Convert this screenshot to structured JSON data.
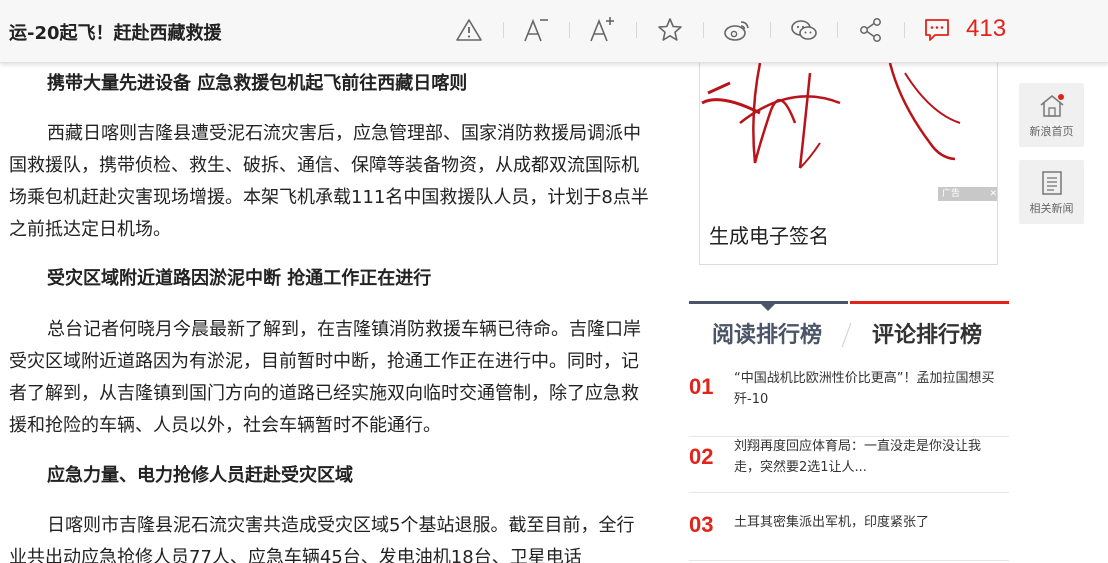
{
  "header": {
    "title": "运-20起飞！赶赴西藏救援",
    "comment_count": "413",
    "accent_color": "#e2231a",
    "icons": [
      "report-icon",
      "font-decrease-icon",
      "font-increase-icon",
      "star-icon",
      "weibo-icon",
      "wechat-icon",
      "share-icon",
      "comment-icon"
    ]
  },
  "article": {
    "paragraphs": [
      {
        "type": "subheading",
        "text": "携带大量先进设备 应急救援包机起飞前往西藏日喀则"
      },
      {
        "type": "body",
        "text": "西藏日喀则吉隆县遭受泥石流灾害后，应急管理部、国家消防救援局调派中国救援队，携带侦检、救生、破拆、通信、保障等装备物资，从成都双流国际机场乘包机赶赴灾害现场增援。本架飞机承载111名中国救援队人员，计划于8点半之前抵达定日机场。"
      },
      {
        "type": "subheading",
        "text": "受灾区域附近道路因淤泥中断 抢通工作正在进行"
      },
      {
        "type": "body",
        "text": "总台记者何晓月今晨最新了解到，在吉隆镇消防救援车辆已待命。吉隆口岸受灾区域附近道路因为有淤泥，目前暂时中断，抢通工作正在进行中。同时，记者了解到，从吉隆镇到国门方向的道路已经实施双向临时交通管制，除了应急救援和抢险的车辆、人员以外，社会车辆暂时不能通行。"
      },
      {
        "type": "subheading",
        "text": "应急力量、电力抢修人员赶赴受灾区域"
      },
      {
        "type": "body",
        "text": "日喀则市吉隆县泥石流灾害共造成受灾区域5个基站退服。截至目前，全行业共出动应急抢修人员77人、应急车辆45台、发电油机18台、卫星电话"
      }
    ]
  },
  "ad": {
    "badge": "广告",
    "caption": "生成电子签名"
  },
  "ranking": {
    "tabs": [
      "阅读排行榜",
      "评论排行榜"
    ],
    "items": [
      {
        "num": "01",
        "text": "“中国战机比欧洲性价比更高”！孟加拉国想买歼-10"
      },
      {
        "num": "02",
        "text": "刘翔再度回应体育局：一直没走是你没让我走，突然要2选1让人..."
      },
      {
        "num": "03",
        "text": "土耳其密集派出军机，印度紧张了"
      }
    ]
  },
  "float_buttons": [
    {
      "label": "新浪首页",
      "icon": "home-icon"
    },
    {
      "label": "相关新闻",
      "icon": "news-list-icon"
    }
  ]
}
